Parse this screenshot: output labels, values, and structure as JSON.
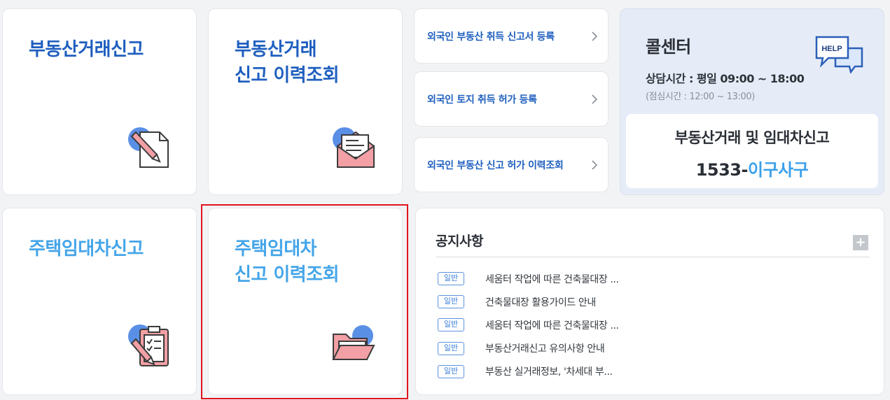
{
  "tiles": {
    "realestate_report": {
      "title": "부동산거래신고"
    },
    "realestate_history": {
      "title": "부동산거래\n신고 이력조회"
    },
    "housing_lease_report": {
      "title": "주택임대차신고"
    },
    "housing_lease_history": {
      "title": "주택임대차\n신고 이력조회"
    }
  },
  "foreigner_links": [
    {
      "label": "외국인 부동산 취득 신고서 등록"
    },
    {
      "label": "외국인 토지 취득 허가 등록"
    },
    {
      "label": "외국인 부동산 신고 허가 이력조회"
    }
  ],
  "call_center": {
    "title": "콜센터",
    "hours": "상담시간 : 평일 09:00 ~ 18:00",
    "break": "(점심시간 : 12:00 ~ 13:00)",
    "service": "부동산거래 및 임대차신고",
    "phone_number": "1533-",
    "phone_word": "이구사구",
    "help_icon_text": "HELP"
  },
  "notice": {
    "title": "공지사항",
    "more": "+",
    "items": [
      {
        "badge": "일반",
        "text": "세움터 작업에 따른 건축물대장 ..."
      },
      {
        "badge": "일반",
        "text": "건축물대장 활용가이드 안내"
      },
      {
        "badge": "일반",
        "text": "세움터 작업에 따른 건축물대장 ..."
      },
      {
        "badge": "일반",
        "text": "부동산거래신고 유의사항 안내"
      },
      {
        "badge": "일반",
        "text": "부동산 실거래정보, '차세대 부..."
      }
    ]
  },
  "colors": {
    "dark_blue": "#1f5fbf",
    "light_blue": "#45a5e9",
    "highlight_red": "#e0141e",
    "icon_pink": "#f2a0a5",
    "icon_blue": "#5a8fe6"
  },
  "icons": {
    "realestate_report": "pencil-document-icon",
    "realestate_history": "envelope-letter-icon",
    "housing_lease_report": "clipboard-checklist-icon",
    "housing_lease_history": "open-folder-icon",
    "call_center": "help-chat-bubble-icon",
    "link": "chevron-right-icon"
  }
}
